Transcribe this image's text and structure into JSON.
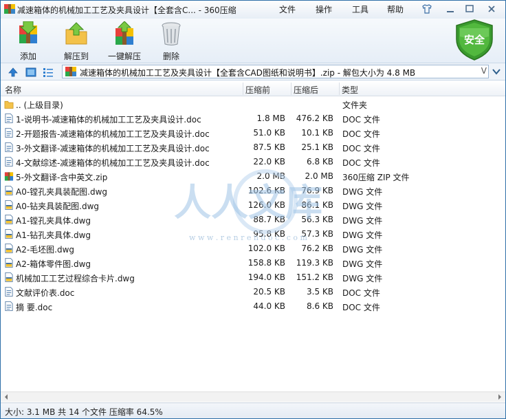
{
  "window": {
    "title": "减速箱体的机械加工工艺及夹具设计【全套含C... - 360压缩"
  },
  "menu": [
    "文件",
    "操作",
    "工具",
    "帮助"
  ],
  "toolbar": {
    "add": "添加",
    "extract_to": "解压到",
    "one_click_extract": "一键解压",
    "delete": "删除"
  },
  "security_badge": "安全",
  "address": {
    "path": "减速箱体的机械加工工艺及夹具设计【全套含CAD图纸和说明书】.zip - 解包大小为 4.8 MB",
    "dropdown": "V"
  },
  "columns": {
    "name": "名称",
    "size": "压缩前",
    "compressed": "压缩后",
    "type": "类型"
  },
  "files": [
    {
      "name": ".. (上级目录)",
      "size": "",
      "compressed": "",
      "type": "文件夹",
      "icon": "folder-icon"
    },
    {
      "name": "1-说明书-减速箱体的机械加工工艺及夹具设计.doc",
      "size": "1.8 MB",
      "compressed": "476.2 KB",
      "type": "DOC 文件",
      "icon": "doc-file-icon"
    },
    {
      "name": "2-开题报告-减速箱体的机械加工工艺及夹具设计.doc",
      "size": "51.0 KB",
      "compressed": "10.1 KB",
      "type": "DOC 文件",
      "icon": "doc-file-icon"
    },
    {
      "name": "3-外文翻译-减速箱体的机械加工工艺及夹具设计.doc",
      "size": "87.5 KB",
      "compressed": "25.1 KB",
      "type": "DOC 文件",
      "icon": "doc-file-icon"
    },
    {
      "name": "4-文献综述-减速箱体的机械加工工艺及夹具设计.doc",
      "size": "22.0 KB",
      "compressed": "6.8 KB",
      "type": "DOC 文件",
      "icon": "doc-file-icon"
    },
    {
      "name": "5-外文翻译-含中英文.zip",
      "size": "2.0 MB",
      "compressed": "2.0 MB",
      "type": "360压缩 ZIP 文件",
      "icon": "zip-file-icon"
    },
    {
      "name": "A0-镗孔夹具装配图.dwg",
      "size": "102.6 KB",
      "compressed": "76.9 KB",
      "type": "DWG 文件",
      "icon": "dwg-file-icon"
    },
    {
      "name": "A0-钻夹具装配图.dwg",
      "size": "126.0 KB",
      "compressed": "86.1 KB",
      "type": "DWG 文件",
      "icon": "dwg-file-icon"
    },
    {
      "name": "A1-镗孔夹具体.dwg",
      "size": "88.7 KB",
      "compressed": "56.3 KB",
      "type": "DWG 文件",
      "icon": "dwg-file-icon"
    },
    {
      "name": "A1-钻孔夹具体.dwg",
      "size": "95.8 KB",
      "compressed": "57.3 KB",
      "type": "DWG 文件",
      "icon": "dwg-file-icon"
    },
    {
      "name": "A2-毛坯图.dwg",
      "size": "102.0 KB",
      "compressed": "76.2 KB",
      "type": "DWG 文件",
      "icon": "dwg-file-icon"
    },
    {
      "name": "A2-箱体零件图.dwg",
      "size": "158.8 KB",
      "compressed": "119.3 KB",
      "type": "DWG 文件",
      "icon": "dwg-file-icon"
    },
    {
      "name": "机械加工工艺过程综合卡片.dwg",
      "size": "194.0 KB",
      "compressed": "151.2 KB",
      "type": "DWG 文件",
      "icon": "dwg-file-icon"
    },
    {
      "name": "文献评价表.doc",
      "size": "20.5 KB",
      "compressed": "3.5 KB",
      "type": "DOC 文件",
      "icon": "doc-file-icon"
    },
    {
      "name": "摘  要.doc",
      "size": "44.0 KB",
      "compressed": "8.6 KB",
      "type": "DOC 文件",
      "icon": "doc-file-icon"
    }
  ],
  "watermark": {
    "text": "人人文库",
    "url": "w w w . r e n r e n d o c . c o m"
  },
  "status": "大小: 3.1 MB 共 14 个文件 压缩率 64.5%"
}
